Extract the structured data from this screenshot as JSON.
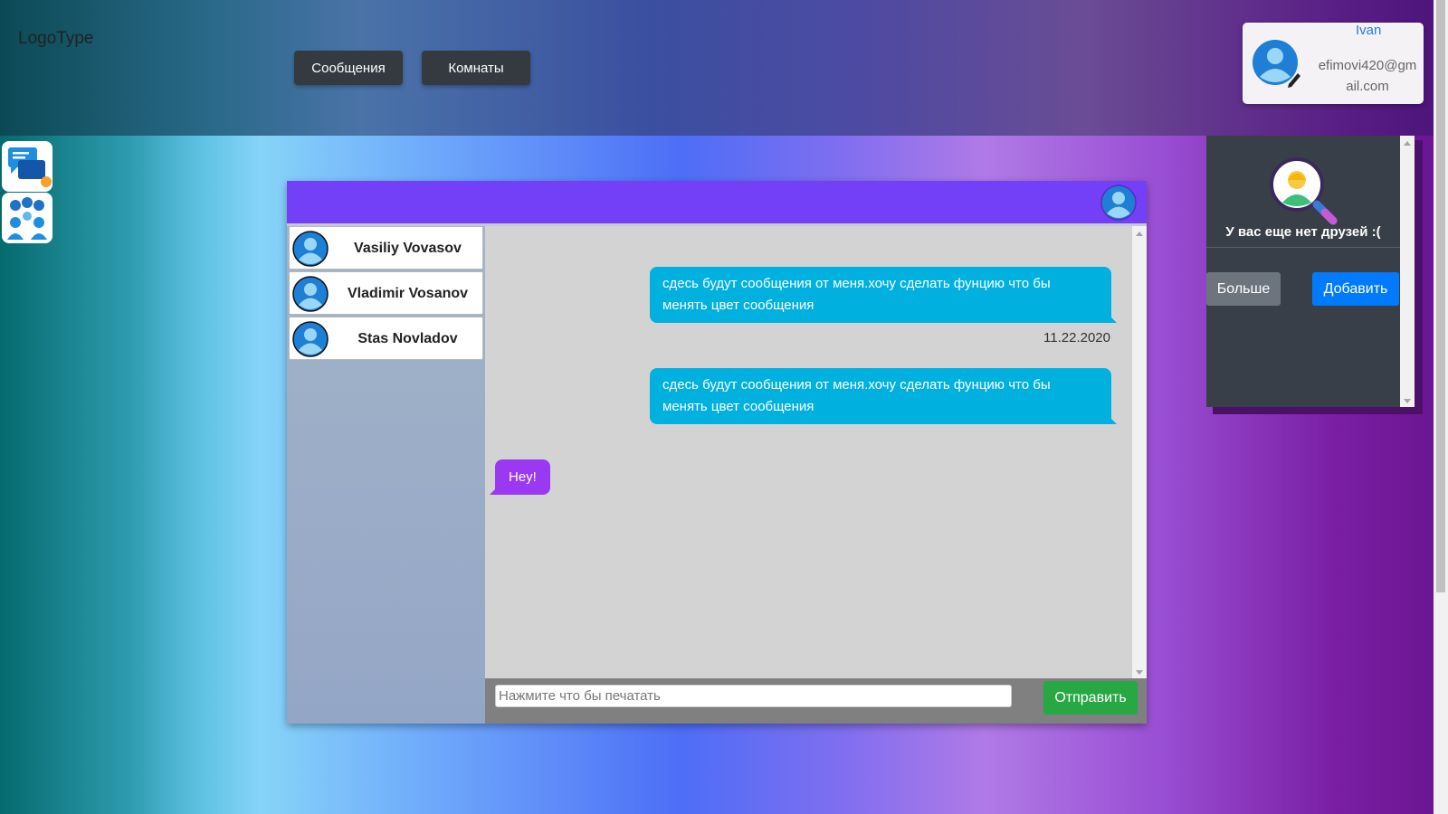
{
  "header": {
    "logo": "LogoType",
    "nav": [
      {
        "label": "Сообщения"
      },
      {
        "label": "Комнаты"
      }
    ]
  },
  "profile": {
    "name": "Ivan",
    "email": "efimovi420@gmail.com"
  },
  "sidebar": {
    "items": [
      {
        "icon": "chat-bubbles-icon"
      },
      {
        "icon": "group-icon"
      }
    ]
  },
  "contacts": [
    {
      "name": "Vasiliy Vovasov"
    },
    {
      "name": "Vladimir Vosanov"
    },
    {
      "name": "Stas Novladov"
    }
  ],
  "messages": {
    "outgoing_1": "сдесь будут сообщения от меня.хочу сделать фунцию что бы менять цвет сообщения",
    "date_1": "11.22.2020",
    "outgoing_2": "сдесь будут сообщения от меня.хочу сделать фунцию что бы менять цвет сообщения",
    "incoming_1": "Hey!"
  },
  "composer": {
    "placeholder": "Нажмите что бы печатать",
    "send_label": "Отправить"
  },
  "friends": {
    "empty_text": "У вас еще нет друзей :(",
    "more_label": "Больше",
    "add_label": "Добавить"
  },
  "colors": {
    "chat_header": "#7340f8",
    "outgoing_bubble": "#00b1e0",
    "incoming_bubble": "#9a38f2",
    "send_button": "#28a745",
    "add_button": "#007bff"
  }
}
